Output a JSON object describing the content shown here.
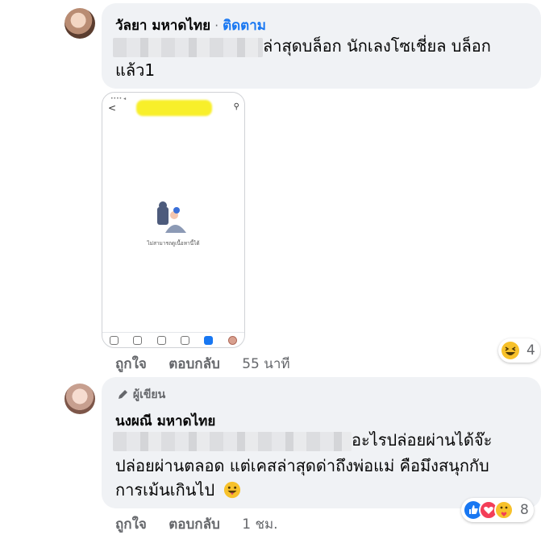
{
  "comments": [
    {
      "author": "วัลยา มหาดไทย",
      "separator": "·",
      "follow_label": "ติดตาม",
      "text_line1": "ล่าสุดบล็อก นักเลงโซเชี่ยล บล็อก",
      "text_line2": "แล้ว1",
      "screenshot_message": "ไม่สามารถดูเนื้อหานี้ได้",
      "like_label": "ถูกใจ",
      "reply_label": "ตอบกลับ",
      "time": "55 นาที",
      "reaction_count": "4",
      "reaction_icons": [
        "haha-emoji-icon"
      ]
    },
    {
      "badge": "ผู้เขียน",
      "author": "นงผณี มหาดไทย",
      "text_line1": "อะไรปล่อยผ่านได้จ๊ะ",
      "text_line2": "ปล่อยผ่านตลอด แต่เคสล่าสุดด่าถึงพ่อแม่ คือมึงสนุกกับ",
      "text_line3": "การเม้นเกินไป",
      "like_label": "ถูกใจ",
      "reply_label": "ตอบกลับ",
      "time": "1 ชม.",
      "reaction_count": "8",
      "reaction_icons": [
        "like-icon",
        "love-icon",
        "care-icon"
      ]
    }
  ],
  "colors": {
    "bubble": "#f0f2f5",
    "link": "#1877f2",
    "secondary_text": "#65676b",
    "highlight_blur": "#f8ef2a"
  }
}
